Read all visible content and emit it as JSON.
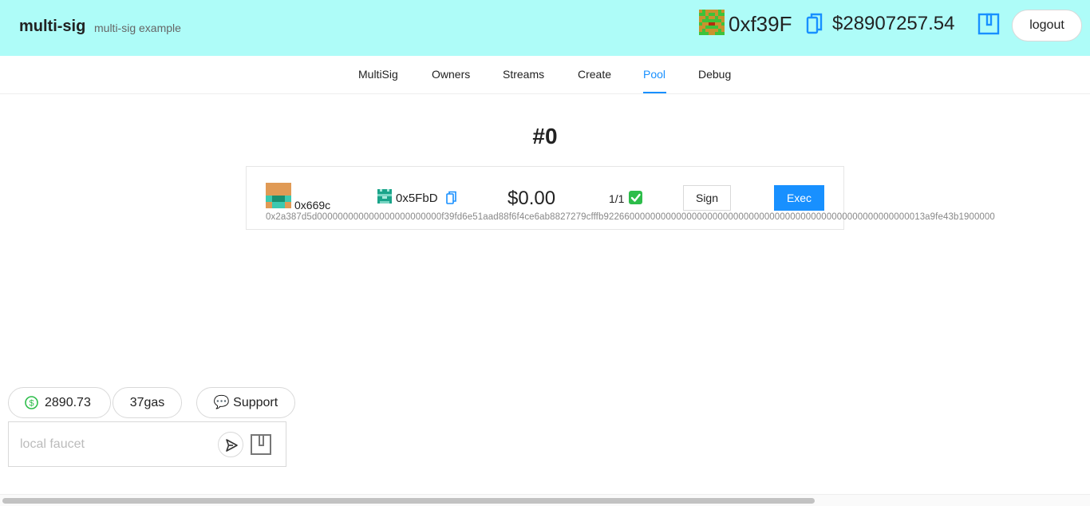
{
  "header": {
    "title": "multi-sig",
    "subtitle": "multi-sig example",
    "address": "0xf39F",
    "balance": "$28907257.54",
    "logout_label": "logout",
    "avatar_icon": "blockie-avatar-icon",
    "copy_icon": "copy-icon",
    "wallet_icon": "wallet-icon",
    "bg_color": "#aefcf8"
  },
  "nav": {
    "tabs": [
      {
        "label": "MultiSig"
      },
      {
        "label": "Owners"
      },
      {
        "label": "Streams"
      },
      {
        "label": "Create"
      },
      {
        "label": "Pool"
      },
      {
        "label": "Debug"
      }
    ],
    "active": "Pool",
    "accent": "#1890ff"
  },
  "pool": {
    "title": "#0",
    "tx": {
      "from": "0x669c",
      "to": "0x5FbD",
      "amount": "$0.00",
      "signatures": "1/1",
      "check_icon": "check-icon",
      "sign_label": "Sign",
      "exec_label": "Exec",
      "calldata": "0x2a387d5d000000000000000000000000f39fd6e51aad88f6f4ce6ab8827279cfffb92266000000000000000000000000000000000000000000000000000000013a9fe43b1900000"
    }
  },
  "footer": {
    "price": "2890.73",
    "gas": "37gas",
    "support_label": "💬 Support",
    "faucet_placeholder": "local faucet",
    "dollar_icon": "dollar-circle-icon",
    "send_icon": "send-icon",
    "faucet_wallet_icon": "wallet-icon"
  }
}
